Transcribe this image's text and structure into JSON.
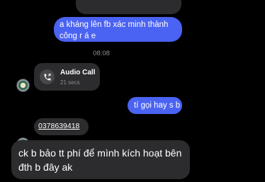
{
  "messages": {
    "sent_1": "a kháng lên fb xác minh thành công r á e",
    "timestamp": "08:08",
    "call": {
      "title": "Audio Call",
      "duration": "21 secs",
      "icon": "phone-icon"
    },
    "sent_2": "tí gọi hay s b",
    "phone_number": "0378639418",
    "received_last": "ck b bảo tt phí để mình kích hoạt bên đth b đây ak"
  },
  "colors": {
    "background": "#000000",
    "sent_bubble": "#4b63f2",
    "received_bubble": "#2c2c2e",
    "muted_text": "#8e8e93"
  }
}
